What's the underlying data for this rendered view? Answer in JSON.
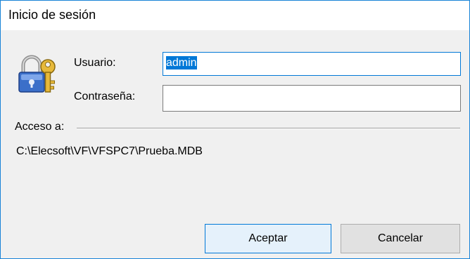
{
  "window": {
    "title": "Inicio de sesión"
  },
  "icons": {
    "login": "lock-key-icon"
  },
  "form": {
    "user_label": "Usuario:",
    "user_value": "admin",
    "password_label": "Contraseña:",
    "password_value": ""
  },
  "access": {
    "label": "Acceso a:",
    "path": "C:\\Elecsoft\\VF\\VFSPC7\\Prueba.MDB"
  },
  "buttons": {
    "ok": "Aceptar",
    "cancel": "Cancelar"
  },
  "colors": {
    "accent": "#0078d7",
    "window_border": "#1883d7",
    "dialog_bg": "#f0f0f0"
  }
}
